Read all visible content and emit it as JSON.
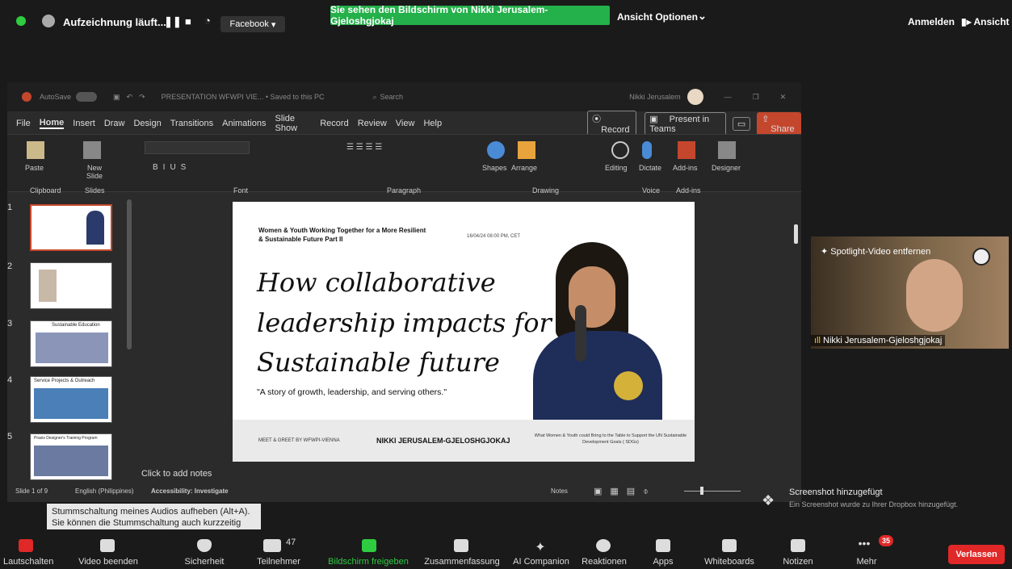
{
  "zoom": {
    "recording_label": "Aufzeichnung läuft...",
    "stream_label": "Facebook",
    "share_banner": "Sie sehen den Bildschirm von Nikki Jerusalem-Gjeloshgjokaj",
    "view_options": "Ansicht Optionen",
    "signin": "Anmelden",
    "view": "Ansicht"
  },
  "ppt": {
    "title": "PRESENTATION WFWPI VIE...  •  Saved to this PC",
    "search": "Search",
    "user": "Nikki Jerusalem",
    "autosave": "AutoSave",
    "menu": [
      "File",
      "Home",
      "Insert",
      "Draw",
      "Design",
      "Transitions",
      "Animations",
      "Slide Show",
      "Record",
      "Review",
      "View",
      "Help"
    ],
    "record_btn": "Record",
    "present_btn": "Present in Teams",
    "share_btn": "Share",
    "groups": [
      "Clipboard",
      "Slides",
      "Font",
      "Paragraph",
      "Drawing",
      "Voice",
      "Add-ins"
    ],
    "ribbon_labels": [
      "Paste",
      "New Slide",
      "Shapes",
      "Arrange",
      "Editing",
      "Dictate",
      "Add-ins",
      "Designer"
    ],
    "notes_placeholder": "Click to add notes",
    "status": {
      "slide": "Slide 1 of 9",
      "language": "English (Philippines)",
      "accessibility": "Accessibility: Investigate",
      "notes": "Notes"
    },
    "thumbs": [
      {
        "num": "1",
        "caption": ""
      },
      {
        "num": "2",
        "caption": ""
      },
      {
        "num": "3",
        "caption": "Sustainable Education"
      },
      {
        "num": "4",
        "caption": "Service Projects & Outreach"
      },
      {
        "num": "5",
        "caption": "Praxis Designer's Training Program"
      }
    ]
  },
  "slide": {
    "header": "Women & Youth Working Together for a More Resilient & Sustainable Future Part II",
    "date": "16/04/24 08:00 PM, CET",
    "title_lines": [
      "How collaborative",
      "leadership impacts for a",
      "Sustainable future"
    ],
    "quote": "\"A story of growth, leadership, and serving others.\"",
    "footer_left": "MEET & GREET BY WFWPI-VIENNA",
    "footer_name": "NIKKI JERUSALEM-GJELOSHGJOKAJ",
    "footer_right": "What Women & Youth could Bring to the Table to Support the UN Sustainable Development Goals ( SDGs)"
  },
  "participant": {
    "spotlight": "Spotlight-Video entfernen",
    "name": "Nikki Jerusalem-Gjeloshgjokaj"
  },
  "tooltip": "Stummschaltung meines Audios aufheben (Alt+A). Sie können die Stummschaltung auch kurzzeitig aufheben, indem Sie die Leertaste gedrückt halten.",
  "toast": {
    "title": "Screenshot hinzugefügt",
    "body": "Ein Screenshot wurde zu Ihrer Dropbox hinzugefügt."
  },
  "toolbar": {
    "unmute": "Lautschalten",
    "video": "Video beenden",
    "security": "Sicherheit",
    "participants": "Teilnehmer",
    "participants_count": "47",
    "share": "Bildschirm freigeben",
    "summary": "Zusammenfassung",
    "ai": "AI Companion",
    "reactions": "Reaktionen",
    "apps": "Apps",
    "whiteboards": "Whiteboards",
    "notes": "Notizen",
    "more": "Mehr",
    "more_badge": "35",
    "leave": "Verlassen"
  },
  "colors": {
    "share_green": "#24b04a",
    "leave_red": "#e02828",
    "ppt_accent": "#c4472d"
  }
}
